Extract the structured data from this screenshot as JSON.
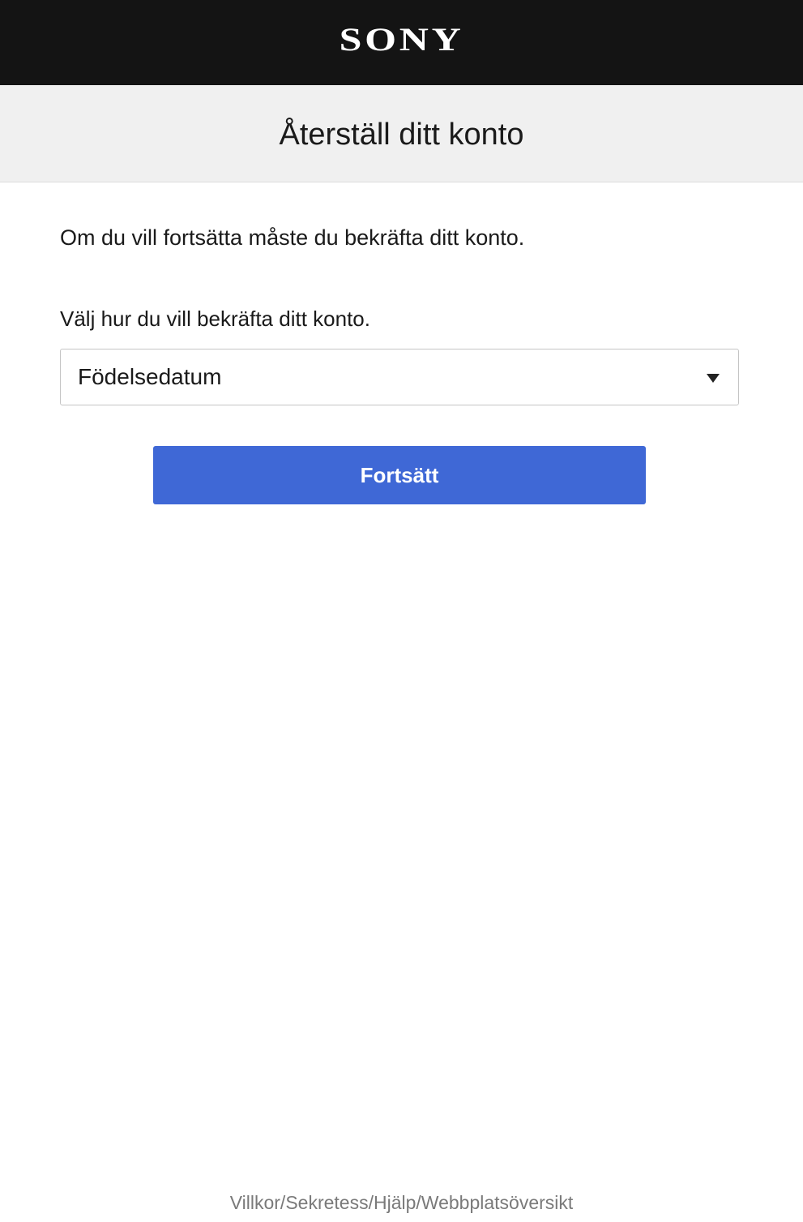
{
  "header": {
    "logo_text": "SONY"
  },
  "title_bar": {
    "title": "Återställ ditt konto"
  },
  "main": {
    "intro_text": "Om du vill fortsätta måste du bekräfta ditt konto.",
    "select_label": "Välj hur du vill bekräfta ditt konto.",
    "select": {
      "selected_value": "Födelsedatum",
      "icon": "chevron-down-icon"
    },
    "continue_label": "Fortsätt"
  },
  "footer": {
    "links": [
      "Villkor",
      "Sekretess",
      "Hjälp",
      "Webbplatsöversikt"
    ],
    "separator": "/"
  },
  "colors": {
    "header_bg": "#141414",
    "title_bar_bg": "#f0f0f0",
    "button_bg": "#3f68d6",
    "footer_text": "#7a7a7a"
  }
}
